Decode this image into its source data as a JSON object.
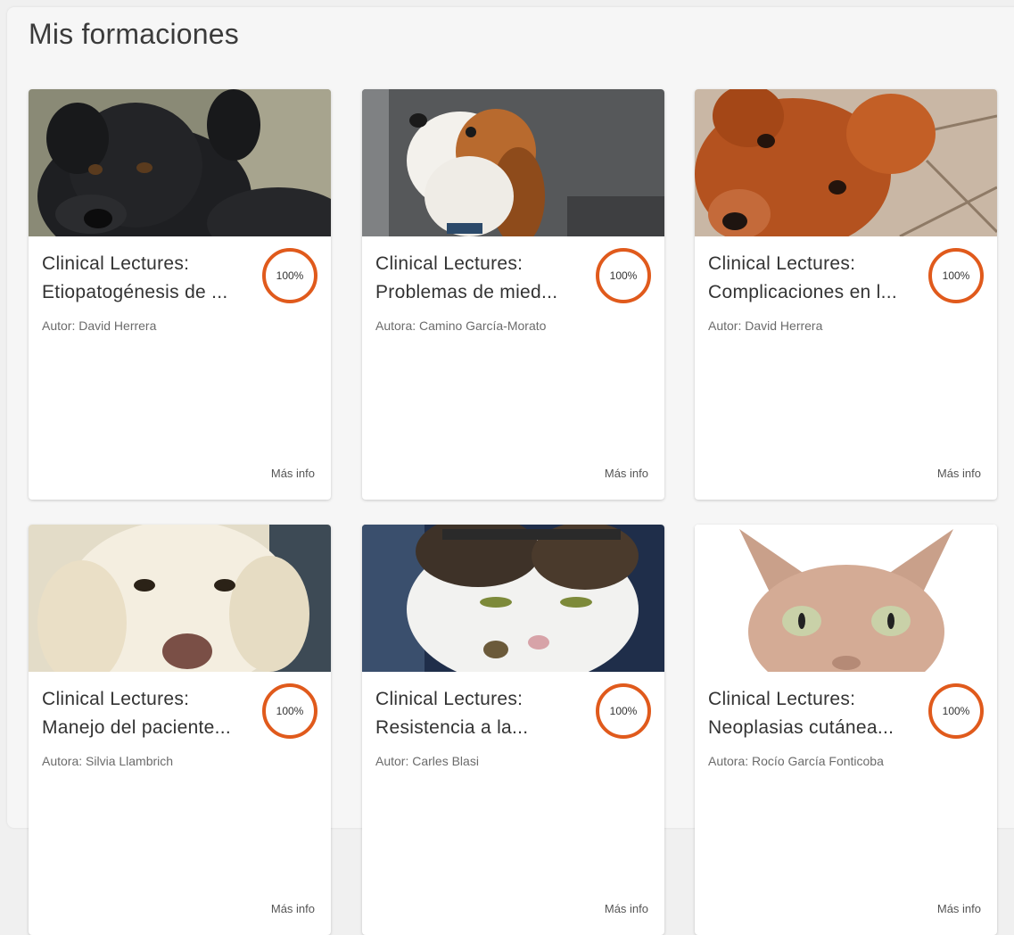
{
  "page": {
    "title": "Mis formaciones"
  },
  "accent_color": "#e05a1c",
  "courses": [
    {
      "title_line1": "Clinical Lectures:",
      "title_line2": "Etiopatogénesis de ...",
      "author": "Autor: David Herrera",
      "progress": "100%",
      "more_info": "Más info",
      "image": "black-dog-photo"
    },
    {
      "title_line1": "Clinical Lectures:",
      "title_line2": "Problemas de mied...",
      "author": "Autora: Camino García-Morato",
      "progress": "100%",
      "more_info": "Más info",
      "image": "beagle-photo"
    },
    {
      "title_line1": "Clinical Lectures:",
      "title_line2": "Complicaciones en l...",
      "author": "Autor: David Herrera",
      "progress": "100%",
      "more_info": "Más info",
      "image": "red-dog-photo"
    },
    {
      "title_line1": "Clinical Lectures:",
      "title_line2": "Manejo del paciente...",
      "author": "Autora: Silvia Llambrich",
      "progress": "100%",
      "more_info": "Más info",
      "image": "golden-retriever-photo"
    },
    {
      "title_line1": "Clinical Lectures:",
      "title_line2": "Resistencia a la...",
      "author": "Autor: Carles Blasi",
      "progress": "100%",
      "more_info": "Más info",
      "image": "cat-photo"
    },
    {
      "title_line1": "Clinical Lectures:",
      "title_line2": "Neoplasias cutánea...",
      "author": "Autora: Rocío García Fonticoba",
      "progress": "100%",
      "more_info": "Más info",
      "image": "sphynx-cat-photo"
    }
  ]
}
